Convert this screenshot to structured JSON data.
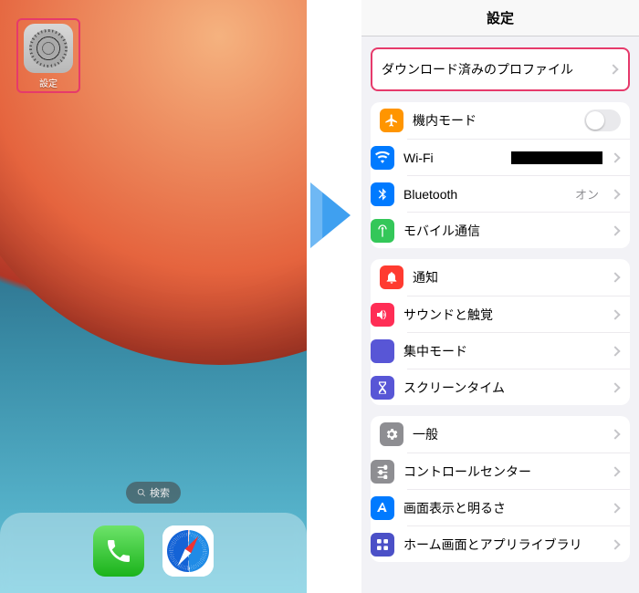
{
  "home": {
    "app_label": "設定",
    "search_label": "検索"
  },
  "settings": {
    "title": "設定",
    "downloaded_profile": "ダウンロード済みのプロファイル",
    "group1": {
      "airplane": "機内モード",
      "wifi": "Wi-Fi",
      "wifi_value": "",
      "bluetooth": "Bluetooth",
      "bluetooth_value": "オン",
      "cellular": "モバイル通信"
    },
    "group2": {
      "notifications": "通知",
      "sounds": "サウンドと触覚",
      "focus": "集中モード",
      "screentime": "スクリーンタイム"
    },
    "group3": {
      "general": "一般",
      "control_center": "コントロールセンター",
      "display": "画面表示と明るさ",
      "home_screen": "ホーム画面とアプリライブラリ"
    }
  }
}
